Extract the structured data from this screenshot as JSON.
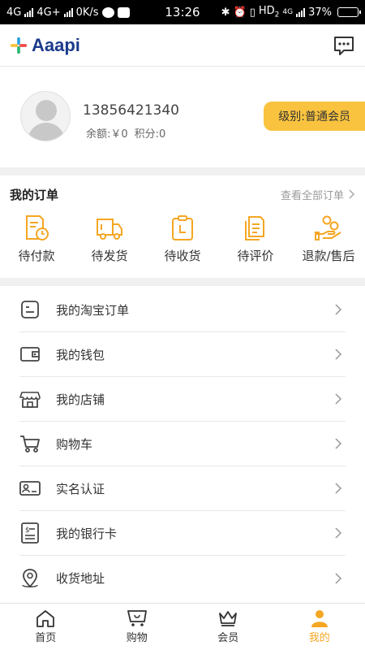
{
  "status_bar": {
    "network1": "4G",
    "network2": "4G+",
    "speed": "0K/s",
    "time": "13:26",
    "hd": "HD",
    "hd_sub": "2",
    "net3": "4G",
    "battery": "37%"
  },
  "header": {
    "logo_text": "Aaapi"
  },
  "profile": {
    "phone": "13856421340",
    "balance": "余额:￥0",
    "points": "积分:0",
    "level": "级别:普通会员"
  },
  "orders": {
    "title": "我的订单",
    "view_all": "查看全部订单",
    "items": [
      {
        "label": "待付款",
        "icon": "pending-payment-icon"
      },
      {
        "label": "待发货",
        "icon": "truck-icon"
      },
      {
        "label": "待收货",
        "icon": "clipboard-icon"
      },
      {
        "label": "待评价",
        "icon": "review-icon"
      },
      {
        "label": "退款/售后",
        "icon": "refund-icon"
      }
    ]
  },
  "menu": {
    "items": [
      {
        "label": "我的淘宝订单",
        "icon": "taobao-order-icon"
      },
      {
        "label": "我的钱包",
        "icon": "wallet-icon"
      },
      {
        "label": "我的店铺",
        "icon": "store-icon"
      },
      {
        "label": "购物车",
        "icon": "cart-icon"
      },
      {
        "label": "实名认证",
        "icon": "id-card-icon"
      },
      {
        "label": "我的银行卡",
        "icon": "bank-card-icon"
      },
      {
        "label": "收货地址",
        "icon": "location-icon"
      }
    ]
  },
  "tabbar": {
    "items": [
      {
        "label": "首页",
        "icon": "home-icon"
      },
      {
        "label": "购物",
        "icon": "shopping-icon"
      },
      {
        "label": "会员",
        "icon": "crown-icon"
      },
      {
        "label": "我的",
        "icon": "user-icon",
        "active": true
      }
    ]
  },
  "colors": {
    "accent": "#f5a623",
    "badge": "#f9c33f",
    "logo": "#1b3a8c"
  }
}
